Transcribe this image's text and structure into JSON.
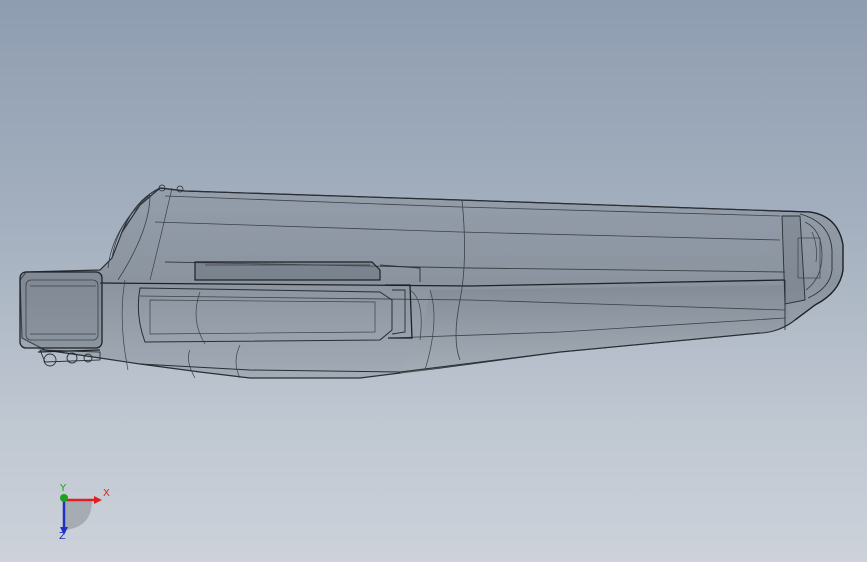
{
  "viewport": {
    "background_top": "#8e9db0",
    "background_bottom": "#cdd2da",
    "model": {
      "display_mode": "transparent-wireframe",
      "edge_color": "#2a2e34",
      "shell_color": "#7d858f"
    }
  },
  "triad": {
    "x_label": "X",
    "y_label": "Y",
    "z_label": "Z",
    "x_color": "#e02020",
    "y_color": "#20a020",
    "z_color": "#2030c0"
  }
}
